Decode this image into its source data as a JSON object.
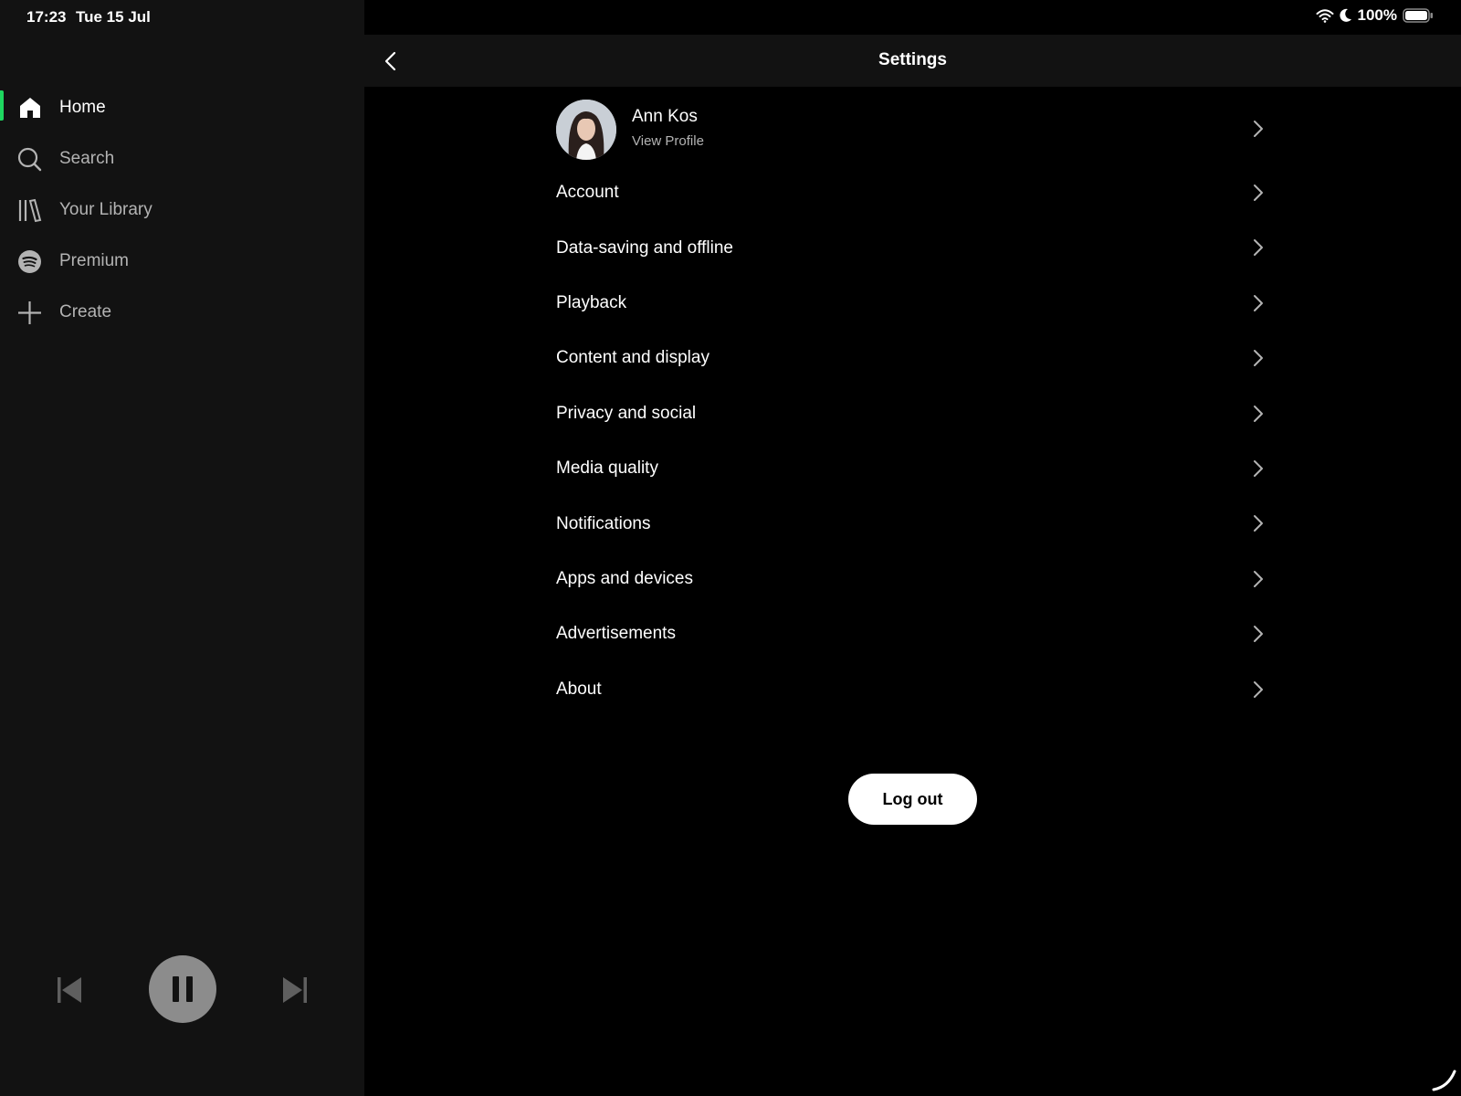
{
  "status_bar": {
    "time": "17:23",
    "date": "Tue 15 Jul",
    "battery": "100%"
  },
  "sidebar": {
    "items": [
      {
        "label": "Home",
        "icon": "home-icon",
        "active": true
      },
      {
        "label": "Search",
        "icon": "search-icon"
      },
      {
        "label": "Your Library",
        "icon": "library-icon"
      },
      {
        "label": "Premium",
        "icon": "spotify-logo-icon"
      },
      {
        "label": "Create",
        "icon": "plus-icon"
      }
    ]
  },
  "player": {
    "state": "playing"
  },
  "header": {
    "title": "Settings"
  },
  "profile": {
    "name": "Ann Kos",
    "subtitle": "View Profile"
  },
  "settings": {
    "items": [
      "Account",
      "Data-saving and offline",
      "Playback",
      "Content and display",
      "Privacy and social",
      "Media quality",
      "Notifications",
      "Apps and devices",
      "Advertisements",
      "About"
    ]
  },
  "logout_label": "Log out",
  "colors": {
    "accent": "#1ed760",
    "sidebar_bg": "#121212",
    "main_bg": "#000000"
  }
}
